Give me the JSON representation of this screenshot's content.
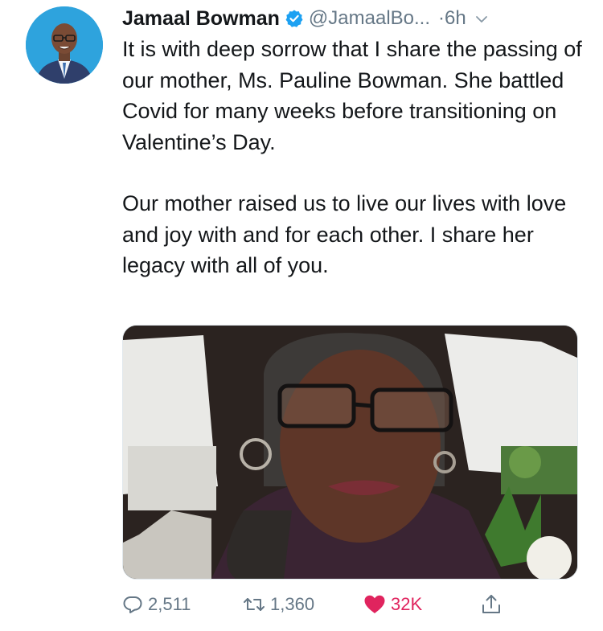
{
  "tweet": {
    "author_name": "Jamaal Bowman",
    "handle": "@JamaalBo...",
    "time": "·6h",
    "paragraphs": [
      "It is with deep sorrow that I share the passing of our mother, Ms. Pauline Bowman. She battled Covid for many weeks before transitioning on Valentine’s Day.",
      "Our mother raised us to live our lives with love and joy with and for each other. I share her legacy with all of you."
    ],
    "verified": true
  },
  "actions": {
    "reply_count": "2,511",
    "retweet_count": "1,360",
    "like_count": "32K",
    "liked": true
  },
  "colors": {
    "accent": "#1da1f2",
    "like": "#e0245e",
    "secondary_text": "#657786"
  },
  "icons": {
    "reply": "reply-icon",
    "retweet": "retweet-icon",
    "like": "heart-icon",
    "share": "share-icon",
    "verified": "verified-badge-icon",
    "menu": "chevron-down-icon"
  }
}
